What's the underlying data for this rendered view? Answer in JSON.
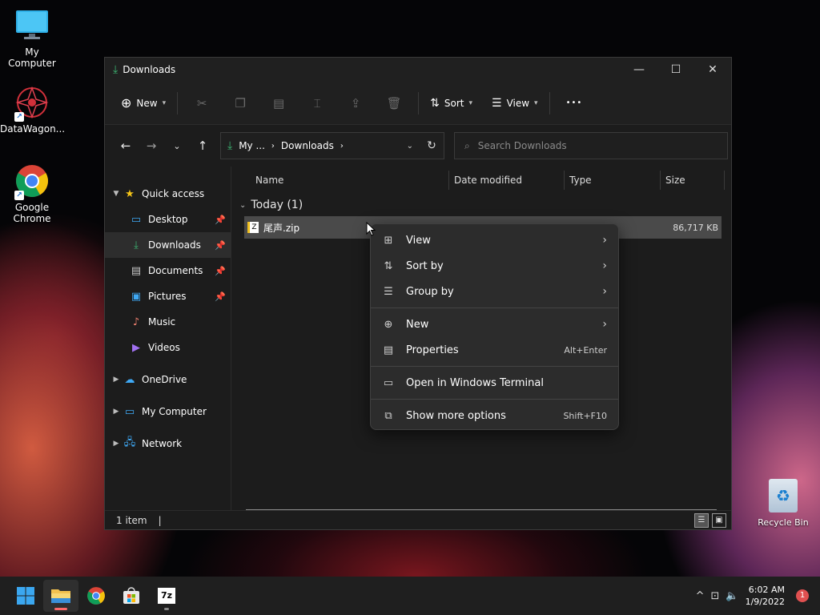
{
  "desktop": {
    "icons": [
      {
        "label": "My Computer"
      },
      {
        "label": "DataWagon..."
      },
      {
        "label": "Google Chrome"
      }
    ],
    "recycle_bin": "Recycle Bin"
  },
  "window": {
    "title": "Downloads",
    "controls": {
      "minimize": "—",
      "maximize": "☐",
      "close": "✕"
    }
  },
  "toolbar": {
    "new_label": "New",
    "sort_label": "Sort",
    "view_label": "View",
    "more": "•••"
  },
  "navbar": {
    "breadcrumb": [
      "My ...",
      "Downloads"
    ],
    "search_placeholder": "Search Downloads"
  },
  "nav_pane": {
    "quick_access": "Quick access",
    "items": [
      {
        "label": "Desktop"
      },
      {
        "label": "Downloads"
      },
      {
        "label": "Documents"
      },
      {
        "label": "Pictures"
      },
      {
        "label": "Music"
      },
      {
        "label": "Videos"
      }
    ],
    "onedrive": "OneDrive",
    "my_computer": "My Computer",
    "network": "Network"
  },
  "columns": {
    "name": "Name",
    "date": "Date modified",
    "type": "Type",
    "size": "Size"
  },
  "group": {
    "label": "Today (1)"
  },
  "files": [
    {
      "name": "尾声.zip",
      "size": "86,717 KB"
    }
  ],
  "status": {
    "count": "1 item"
  },
  "context_menu": {
    "view": "View",
    "sort_by": "Sort by",
    "group_by": "Group by",
    "new": "New",
    "properties": "Properties",
    "properties_shortcut": "Alt+Enter",
    "terminal": "Open in Windows Terminal",
    "more_options": "Show more options",
    "more_options_shortcut": "Shift+F10"
  },
  "taskbar": {
    "time": "6:02 AM",
    "date": "1/9/2022",
    "notifications": "1",
    "sevenzip": "7z"
  }
}
